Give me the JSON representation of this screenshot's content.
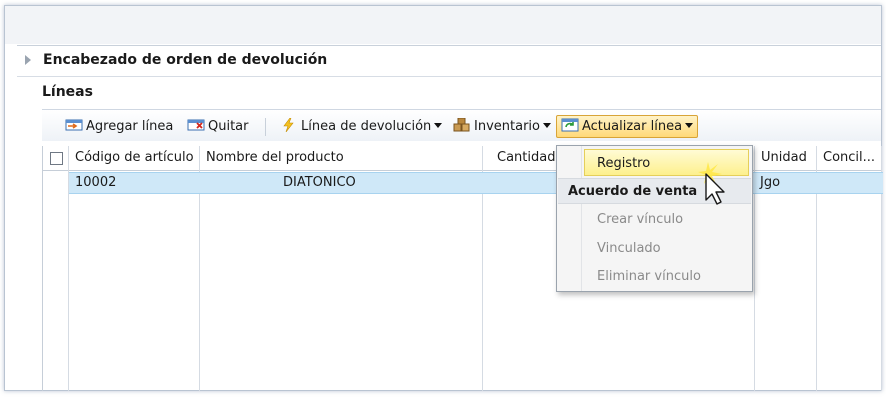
{
  "section": {
    "title": "Encabezado de orden de devolución"
  },
  "lines": {
    "title": "Líneas"
  },
  "toolbar": {
    "add_line": "Agregar línea",
    "remove": "Quitar",
    "return_line": "Línea de devolución",
    "inventory": "Inventario",
    "update_line": "Actualizar línea"
  },
  "grid": {
    "columns": [
      "Código de artículo",
      "Nombre del producto",
      "Cantidad R",
      "Unidad",
      "Concil..."
    ],
    "rows": [
      {
        "code": "10002",
        "name": "DIATONICO",
        "unit": "Jgo"
      }
    ]
  },
  "menu": {
    "items": [
      "Registro"
    ],
    "group": "Acuerdo de venta",
    "disabled_items": [
      "Crear vínculo",
      "Vinculado",
      "Eliminar vínculo"
    ]
  }
}
